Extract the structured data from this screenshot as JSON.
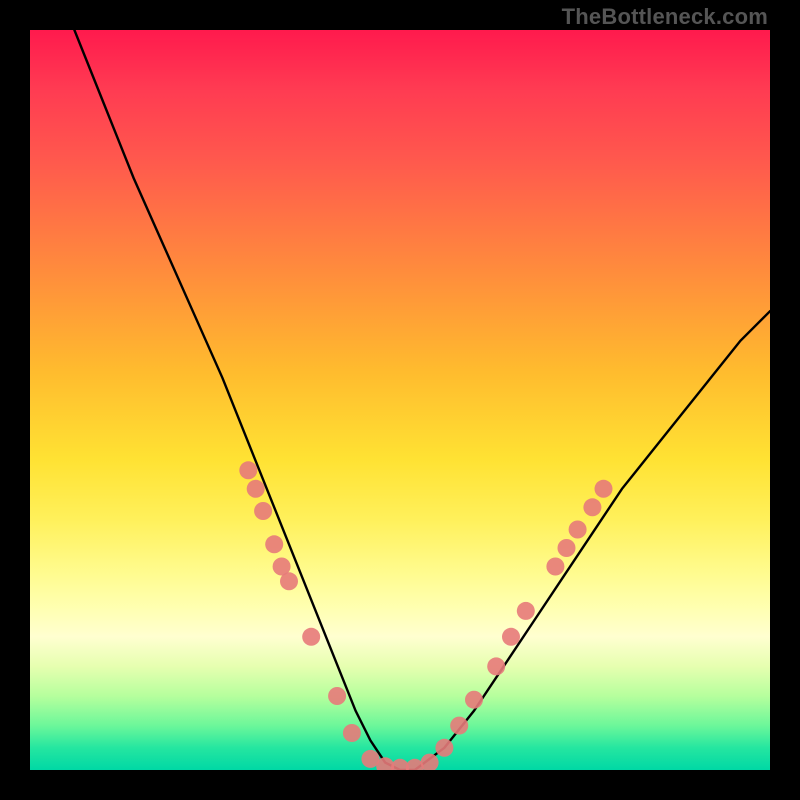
{
  "attribution": "TheBottleneck.com",
  "chart_data": {
    "type": "line",
    "title": "",
    "xlabel": "",
    "ylabel": "",
    "xlim": [
      0,
      100
    ],
    "ylim": [
      0,
      100
    ],
    "grid": false,
    "series": [
      {
        "name": "bottleneck-curve",
        "x": [
          6,
          10,
          14,
          18,
          22,
          26,
          28,
          30,
          32,
          34,
          36,
          38,
          40,
          42,
          44,
          46,
          48,
          50,
          52,
          56,
          60,
          64,
          68,
          72,
          76,
          80,
          84,
          88,
          92,
          96,
          100
        ],
        "y": [
          100,
          90,
          80,
          71,
          62,
          53,
          48,
          43,
          38,
          33,
          28,
          23,
          18,
          13,
          8,
          4,
          1,
          0,
          0,
          3,
          8,
          14,
          20,
          26,
          32,
          38,
          43,
          48,
          53,
          58,
          62
        ]
      }
    ],
    "markers": [
      {
        "x": 29.5,
        "y": 40.5
      },
      {
        "x": 30.5,
        "y": 38.0
      },
      {
        "x": 31.5,
        "y": 35.0
      },
      {
        "x": 33.0,
        "y": 30.5
      },
      {
        "x": 34.0,
        "y": 27.5
      },
      {
        "x": 35.0,
        "y": 25.5
      },
      {
        "x": 38.0,
        "y": 18.0
      },
      {
        "x": 41.5,
        "y": 10.0
      },
      {
        "x": 43.5,
        "y": 5.0
      },
      {
        "x": 46.0,
        "y": 1.5
      },
      {
        "x": 48.0,
        "y": 0.5
      },
      {
        "x": 50.0,
        "y": 0.3
      },
      {
        "x": 52.0,
        "y": 0.3
      },
      {
        "x": 54.0,
        "y": 1.0
      },
      {
        "x": 56.0,
        "y": 3.0
      },
      {
        "x": 58.0,
        "y": 6.0
      },
      {
        "x": 60.0,
        "y": 9.5
      },
      {
        "x": 63.0,
        "y": 14.0
      },
      {
        "x": 65.0,
        "y": 18.0
      },
      {
        "x": 67.0,
        "y": 21.5
      },
      {
        "x": 71.0,
        "y": 27.5
      },
      {
        "x": 72.5,
        "y": 30.0
      },
      {
        "x": 74.0,
        "y": 32.5
      },
      {
        "x": 76.0,
        "y": 35.5
      },
      {
        "x": 77.5,
        "y": 38.0
      }
    ],
    "marker_color": "#e77a7a",
    "curve_color": "#000000",
    "background": "rainbow-gradient"
  }
}
